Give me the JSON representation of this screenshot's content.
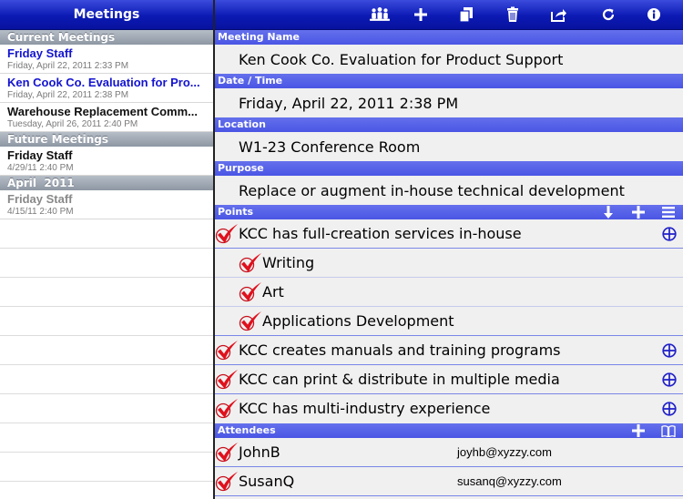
{
  "sidebar": {
    "title": "Meetings",
    "sections": [
      {
        "label": "Current Meetings",
        "items": [
          {
            "title": "Friday Staff",
            "date": "Friday, April 22, 2011 2:33 PM",
            "state": "active"
          },
          {
            "title": "Ken Cook Co. Evaluation for Pro...",
            "date": "Friday, April 22, 2011 2:38 PM",
            "state": "active"
          },
          {
            "title": "Warehouse Replacement Comm...",
            "date": "Tuesday, April 26, 2011 2:40 PM",
            "state": "normal"
          }
        ]
      },
      {
        "label": "Future Meetings",
        "items": [
          {
            "title": "Friday Staff",
            "date": "4/29/11 2:40 PM",
            "state": "normal"
          }
        ]
      },
      {
        "label": "April  2011",
        "items": [
          {
            "title": "Friday Staff",
            "date": "4/15/11 2:40 PM",
            "state": "past"
          }
        ]
      }
    ]
  },
  "toolbar": {
    "icons": [
      "people-icon",
      "add-icon",
      "copy-icon",
      "trash-icon",
      "share-icon",
      "refresh-icon",
      "info-icon"
    ]
  },
  "meeting": {
    "name_label": "Meeting Name",
    "name": "Ken Cook Co. Evaluation for Product Support",
    "datetime_label": "Date / Time",
    "datetime": "Friday, April 22, 2011 2:38 PM",
    "location_label": "Location",
    "location": "W1-23 Conference Room",
    "purpose_label": "Purpose",
    "purpose": "Replace or augment in-house technical development"
  },
  "points": {
    "label": "Points",
    "items": [
      {
        "text": "KCC has full-creation services in-house",
        "level": 0,
        "checked": true,
        "expandable": true
      },
      {
        "text": "Writing",
        "level": 1,
        "checked": true,
        "expandable": false
      },
      {
        "text": "Art",
        "level": 1,
        "checked": true,
        "expandable": false
      },
      {
        "text": "Applications Development",
        "level": 1,
        "checked": true,
        "expandable": false
      },
      {
        "text": "KCC creates manuals and training programs",
        "level": 0,
        "checked": true,
        "expandable": true
      },
      {
        "text": "KCC can print & distribute in multiple media",
        "level": 0,
        "checked": true,
        "expandable": true
      },
      {
        "text": "KCC has multi-industry experience",
        "level": 0,
        "checked": true,
        "expandable": true
      }
    ]
  },
  "attendees": {
    "label": "Attendees",
    "items": [
      {
        "name": "JohnB",
        "email": "joyhb@xyzzy.com"
      },
      {
        "name": "SusanQ",
        "email": "susanq@xyzzy.com"
      }
    ]
  },
  "colors": {
    "bar": "#0c1ab4",
    "header": "#5561e8",
    "check": "#e0101c",
    "expand": "#2020c8"
  }
}
